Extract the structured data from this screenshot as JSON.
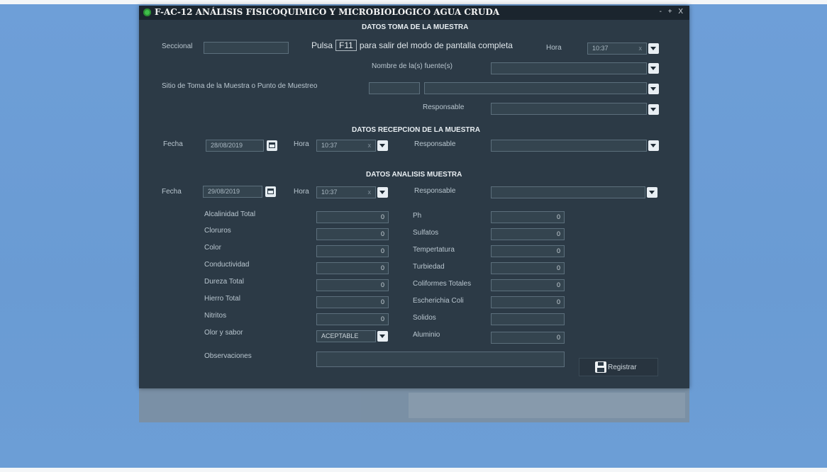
{
  "window": {
    "title": "F-AC-12 ANÁLISIS FISICOQUIMICO Y MICROBIOLOGICO AGUA CRUDA",
    "controls": "- + X"
  },
  "overlay": {
    "prefix": "Pulsa",
    "key": "F11",
    "suffix": "para salir del modo de pantalla completa"
  },
  "toma": {
    "section": "DATOS TOMA DE LA MUESTRA",
    "seccional_label": "Seccional",
    "hora_label": "Hora",
    "hora_value": "10:37",
    "fuente_label": "Nombre de la(s) fuente(s)",
    "sitio_label": "Sitio de Toma de la Muestra o Punto de Muestreo",
    "responsable_label": "Responsable"
  },
  "recepcion": {
    "section": "DATOS RECEPCION DE LA MUESTRA",
    "fecha_label": "Fecha",
    "fecha_value": "28/08/2019",
    "hora_label": "Hora",
    "hora_value": "10:37",
    "responsable_label": "Responsable"
  },
  "analisis": {
    "section": "DATOS ANALISIS MUESTRA",
    "fecha_label": "Fecha",
    "fecha_value": "29/08/2019",
    "hora_label": "Hora",
    "hora_value": "10:37",
    "responsable_label": "Responsable",
    "left_params": [
      {
        "label": "Alcalinidad Total",
        "value": "0"
      },
      {
        "label": "Cloruros",
        "value": "0"
      },
      {
        "label": "Color",
        "value": "0"
      },
      {
        "label": "Conductividad",
        "value": "0"
      },
      {
        "label": "Dureza Total",
        "value": "0"
      },
      {
        "label": "Hierro Total",
        "value": "0"
      },
      {
        "label": "Nitritos",
        "value": "0"
      },
      {
        "label": "Olor y sabor",
        "value": "ACEPTABLE"
      }
    ],
    "right_params": [
      {
        "label": "Ph",
        "value": "0"
      },
      {
        "label": "Sulfatos",
        "value": "0"
      },
      {
        "label": "Tempertatura",
        "value": "0"
      },
      {
        "label": "Turbiedad",
        "value": "0"
      },
      {
        "label": "Coliformes Totales",
        "value": "0"
      },
      {
        "label": "Escherichia Coli",
        "value": "0"
      },
      {
        "label": "Solidos",
        "value": ""
      },
      {
        "label": "Aluminio",
        "value": "0"
      }
    ],
    "observaciones_label": "Observaciones"
  },
  "actions": {
    "save_label": "Registrar"
  },
  "icons": {
    "app": "app-logo-icon",
    "save": "floppy-disk-icon",
    "calendar": "calendar-icon",
    "dropdown": "chevron-down-icon"
  }
}
